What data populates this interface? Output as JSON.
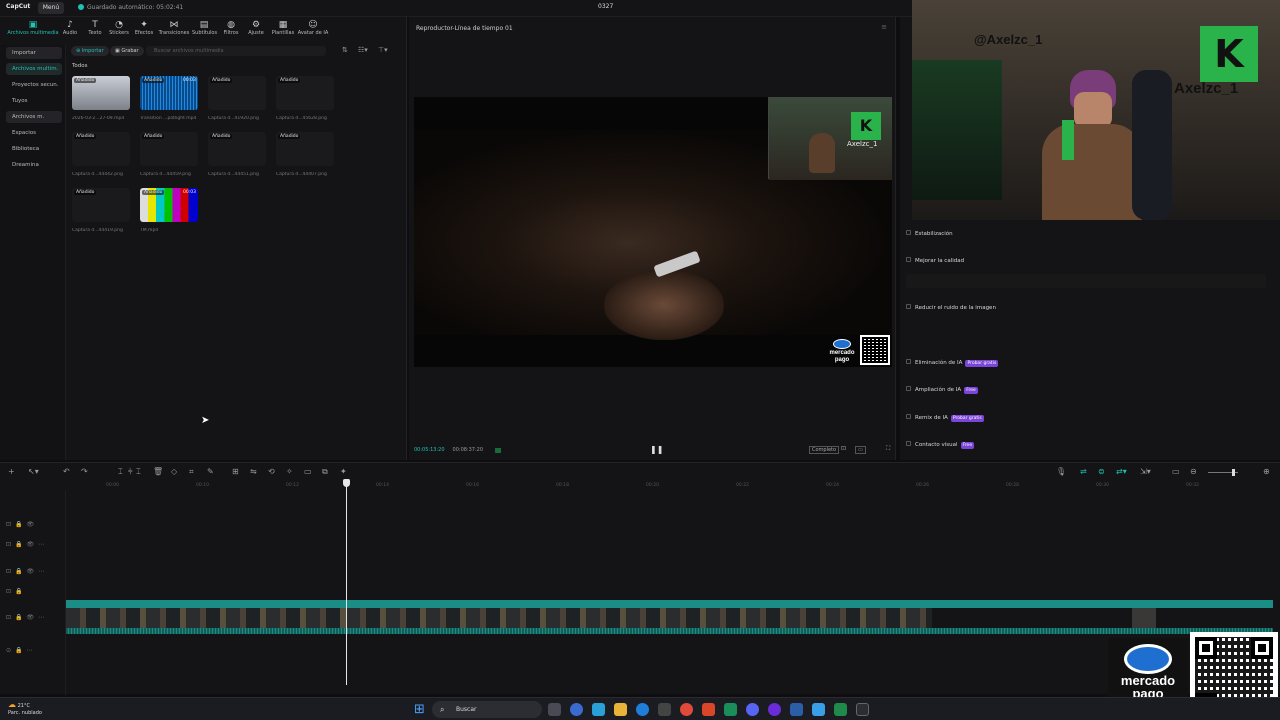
{
  "topbar": {
    "brand": "CapCut",
    "menu": "Menú",
    "saved": "Guardado automático: 05:02:41",
    "title": "0327"
  },
  "media_tools": [
    {
      "label": "Archivos multimedia",
      "icon": "media-icon"
    },
    {
      "label": "Audio",
      "icon": "audio-icon"
    },
    {
      "label": "Texto",
      "icon": "text-icon"
    },
    {
      "label": "Stickers",
      "icon": "sticker-icon"
    },
    {
      "label": "Efectos",
      "icon": "effects-icon"
    },
    {
      "label": "Transiciones",
      "icon": "transition-icon"
    },
    {
      "label": "Subtítulos",
      "icon": "subtitle-icon"
    },
    {
      "label": "Filtros",
      "icon": "filter-icon"
    },
    {
      "label": "Ajuste",
      "icon": "adjust-icon"
    },
    {
      "label": "Plantillas",
      "icon": "template-icon"
    },
    {
      "label": "Avatar de IA",
      "icon": "avatar-icon"
    }
  ],
  "leftnav": [
    "Importar",
    "Archivos multim.",
    "Proyectos secun.",
    "Tuyos",
    "Archivos m.",
    "Espacios",
    "Biblioteca",
    "Dreamina"
  ],
  "media_toolbar": {
    "import": "Importar",
    "record": "Grabar",
    "search_placeholder": "Buscar archivos multimedia"
  },
  "media_section": "Todos",
  "media_items": [
    {
      "tag": "Añadido",
      "name": "2026-03-2...27-09.mp4",
      "dur": ""
    },
    {
      "tag": "Añadido",
      "name": "Transition ...potlight.mp4",
      "dur": "00:03"
    },
    {
      "tag": "Añadido",
      "name": "Captura d...41920.png",
      "dur": ""
    },
    {
      "tag": "Añadido",
      "name": "Captura d...45628.png",
      "dur": ""
    },
    {
      "tag": "Añadido",
      "name": "Captura d...44442.png",
      "dur": ""
    },
    {
      "tag": "Añadido",
      "name": "Captura d...44459.png",
      "dur": ""
    },
    {
      "tag": "Añadido",
      "name": "Captura d...44451.png",
      "dur": ""
    },
    {
      "tag": "Añadido",
      "name": "Captura d...44407.png",
      "dur": ""
    },
    {
      "tag": "Añadido",
      "name": "Captura d...44419.png",
      "dur": ""
    },
    {
      "tag": "Añadido",
      "name": "TM.mp4",
      "dur": "00:03"
    }
  ],
  "player": {
    "title": "Reproductor-Línea de tiempo 01",
    "current": "00:05:13:20",
    "total": "00:08:37:20",
    "ratio": "Completo",
    "pip_label": "Axelzc_1"
  },
  "props": [
    {
      "label": "Estabilización",
      "badge": ""
    },
    {
      "label": "Mejorar la calidad",
      "badge": ""
    },
    {
      "label": "Reducir el ruido de la imagen",
      "badge": ""
    },
    {
      "label": "Eliminación de IA",
      "badge": "Probar gratis"
    },
    {
      "label": "Ampliación de IA",
      "badge": "Free"
    },
    {
      "label": "Remix de IA",
      "badge": "Probar gratis"
    },
    {
      "label": "Contacto visual",
      "badge": "Free"
    }
  ],
  "webcam": {
    "handle": "@Axelzc_1",
    "wall_text": "Axelzc_1"
  },
  "ruler_ticks": [
    "00:00",
    "00:10",
    "00:12",
    "00:14",
    "00:16",
    "00:18",
    "00:20",
    "00:22",
    "00:24",
    "00:26",
    "00:28",
    "00:30",
    "00:32"
  ],
  "taskbar": {
    "temp": "21°C",
    "weather": "Parc. nublado",
    "search": "Buscar"
  },
  "overlay": {
    "brand_line1": "mercado",
    "brand_line2": "pago"
  },
  "colors": {
    "accent": "#21c1b6",
    "badge": "#7a45d8",
    "track": "#1a8e86"
  }
}
